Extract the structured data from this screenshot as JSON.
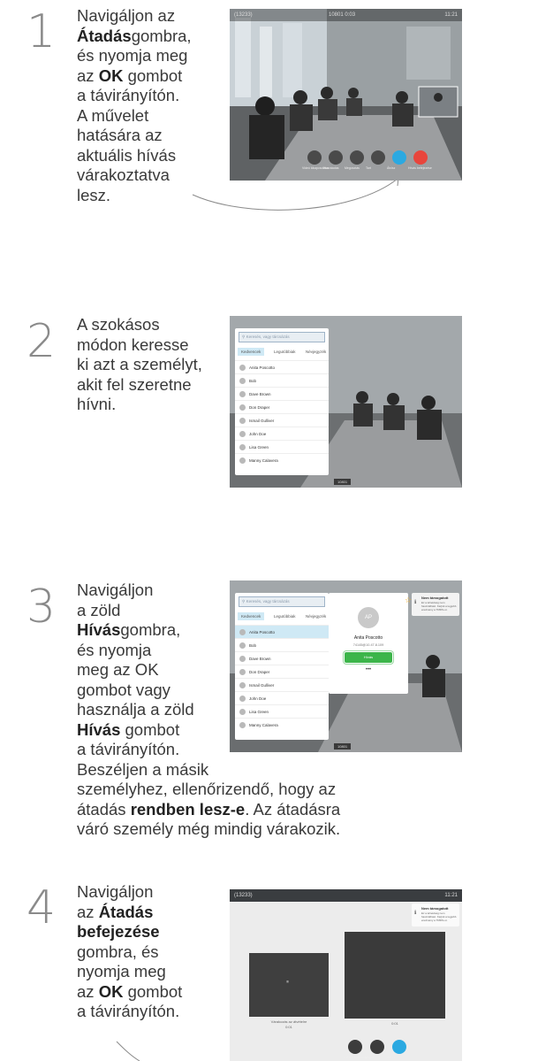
{
  "steps": [
    {
      "number": "1",
      "lines": [
        [
          {
            "t": "Navigáljon az"
          }
        ],
        [
          {
            "t": "Átadás",
            "b": true
          },
          {
            "t": "gombra,"
          }
        ],
        [
          {
            "t": "és nyomja meg"
          }
        ],
        [
          {
            "t": "az "
          },
          {
            "t": "OK",
            "b": true
          },
          {
            "t": " gombot"
          }
        ],
        [
          {
            "t": "a távirányítón."
          }
        ],
        [
          {
            "t": "A művelet"
          }
        ],
        [
          {
            "t": "hatására az"
          }
        ],
        [
          {
            "t": "aktuális hívás"
          }
        ],
        [
          {
            "t": "várakoztatva"
          }
        ],
        [
          {
            "t": "lesz."
          }
        ]
      ]
    },
    {
      "number": "2",
      "lines": [
        [
          {
            "t": "A szokásos"
          }
        ],
        [
          {
            "t": "módon keresse"
          }
        ],
        [
          {
            "t": "ki azt a személyt,"
          }
        ],
        [
          {
            "t": "akit fel szeretne"
          }
        ],
        [
          {
            "t": "hívni."
          }
        ]
      ]
    },
    {
      "number": "3",
      "lines": [
        [
          {
            "t": "Navigáljon"
          }
        ],
        [
          {
            "t": "a zöld"
          }
        ],
        [
          {
            "t": "Hívás",
            "b": true
          },
          {
            "t": "gombra,"
          }
        ],
        [
          {
            "t": "és nyomja"
          }
        ],
        [
          {
            "t": "meg az OK"
          }
        ],
        [
          {
            "t": "gombot vagy"
          }
        ],
        [
          {
            "t": "használja a zöld"
          }
        ],
        [
          {
            "t": "Hívás",
            "b": true
          },
          {
            "t": " gombot"
          }
        ],
        [
          {
            "t": "a távirányítón."
          }
        ],
        [
          {
            "t": "Beszéljen a másik"
          }
        ],
        [
          {
            "t": "személyhez, ellenőrizendő, hogy az"
          }
        ],
        [
          {
            "t": "átadás "
          },
          {
            "t": "rendben lesz-e",
            "b": true
          },
          {
            "t": ". Az átadásra"
          }
        ],
        [
          {
            "t": "váró személy még mindig várakozik."
          }
        ]
      ]
    },
    {
      "number": "4",
      "lines": [
        [
          {
            "t": "Navigáljon"
          }
        ],
        [
          {
            "t": "az "
          },
          {
            "t": "Átadás",
            "b": true
          }
        ],
        [
          {
            "t": "befejezése",
            "b": true
          }
        ],
        [
          {
            "t": "gombra, és"
          }
        ],
        [
          {
            "t": "nyomja meg"
          }
        ],
        [
          {
            "t": "az "
          },
          {
            "t": "OK",
            "b": true
          },
          {
            "t": " gombot"
          }
        ],
        [
          {
            "t": "a távirányítón."
          }
        ]
      ]
    }
  ],
  "shot1": {
    "top_left": "(13233)",
    "top_center": "10801 0:03",
    "top_right": "11:21",
    "controls": [
      {
        "label": "Videó kikapcsolása",
        "color": "#4a4a4a"
      },
      {
        "label": "Hozzáadás",
        "color": "#4a4a4a"
      },
      {
        "label": "Megosztás",
        "color": "#4a4a4a"
      },
      {
        "label": "Tart",
        "color": "#4a4a4a"
      },
      {
        "label": "Átvisz",
        "color": "#2ba9e1"
      },
      {
        "label": "Hívás befejezése",
        "color": "#e8453c"
      }
    ]
  },
  "directory": {
    "search_placeholder": "Keresés, vagy tárcsázás",
    "tabs": [
      "Kedvencek",
      "Legutóbbiak",
      "Névjegyzék"
    ],
    "contacts": [
      "Anita Poscotto",
      "Bob",
      "Dave Brown",
      "Don Draper",
      "Ismail Gulliver",
      "John Doe",
      "Lisa Green",
      "Manny Calavera"
    ],
    "footer": "10801"
  },
  "shot3": {
    "avatar": "AP",
    "name": "Anita Poscotto",
    "address": "74145@10.47.8.109",
    "call_label": "Hívás",
    "more": "•••",
    "notice_title": "Nem támogatott",
    "notice_body": "Ez a lehetőség nem használható. Kérjük a legjobb eredmény a TMDS-ot.",
    "footer": "10801"
  },
  "shot4": {
    "top_left": "(13233)",
    "top_right": "11:21",
    "notice_title": "Nem támogatott",
    "notice_body": "Ez a lehetőség nem használható. Kérjük a legjobb eredmény a TMDS-ot.",
    "left_caption": "Várakozás az átvételre",
    "left_time": "0:01",
    "right_time": "0:01",
    "controls": [
      {
        "label": "Videó kikapcsolása",
        "color": "#3c3c3c"
      },
      {
        "label": "Mégse",
        "color": "#3c3c3c"
      },
      {
        "label": "Átvisz",
        "color": "#2ba9e1"
      }
    ]
  },
  "colors": {
    "accent": "#2ba9e1",
    "end_call": "#e8453c",
    "call_green": "#3cb54a",
    "star": "#f5b335"
  }
}
